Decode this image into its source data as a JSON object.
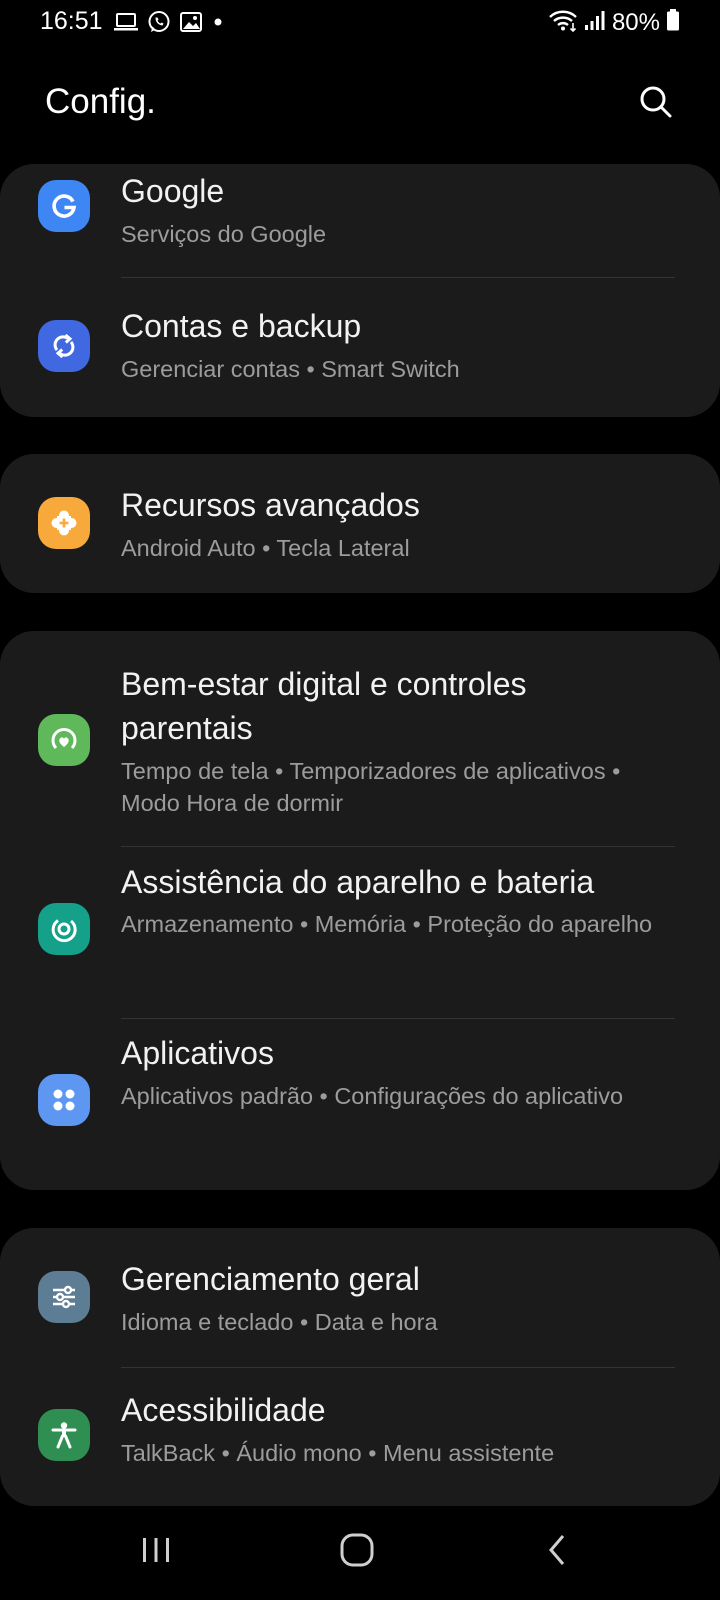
{
  "status_bar": {
    "time": "16:51",
    "notification_icons": [
      "laptop-icon",
      "whatsapp-icon",
      "gallery-icon",
      "dot-icon"
    ],
    "system_icons": [
      "wifi-icon",
      "signal-icon"
    ],
    "battery_percent": "80%"
  },
  "header": {
    "title": "Config.",
    "search_icon": "search-icon"
  },
  "settings": {
    "google": {
      "title": "Google",
      "subtitle": "Serviços do Google",
      "icon": "google-icon",
      "icon_color": "#3f86f5"
    },
    "accounts": {
      "title": "Contas e backup",
      "subtitle": "Gerenciar contas  •  Smart Switch",
      "icon": "sync-icon",
      "icon_color": "#4068e0"
    },
    "advanced": {
      "title": "Recursos avançados",
      "subtitle": "Android Auto  •  Tecla Lateral",
      "icon": "puzzle-plus-icon",
      "icon_color": "#f8a93b"
    },
    "wellbeing": {
      "title": "Bem-estar digital e controles\nparentais",
      "subtitle": "Tempo de tela  •  Temporizadores de aplicativos  •  Modo Hora de dormir",
      "icon": "wellbeing-icon",
      "icon_color": "#5fb85a"
    },
    "device_care": {
      "title": "Assistência do aparelho e bateria",
      "subtitle": "Armazenamento  •  Memória  •  Proteção do aparelho",
      "icon": "device-care-icon",
      "icon_color": "#15a08a"
    },
    "apps": {
      "title": "Aplicativos",
      "subtitle": "Aplicativos padrão  •  Configurações do aplicativo",
      "icon": "apps-grid-icon",
      "icon_color": "#5d97f2"
    },
    "general": {
      "title": "Gerenciamento geral",
      "subtitle": "Idioma e teclado  •  Data e hora",
      "icon": "sliders-icon",
      "icon_color": "#5d7d95"
    },
    "accessibility": {
      "title": "Acessibilidade",
      "subtitle": "TalkBack  •  Áudio mono  •  Menu assistente",
      "icon": "accessibility-icon",
      "icon_color": "#2f8e52"
    }
  },
  "nav_bar": {
    "recents_icon": "recents-icon",
    "home_icon": "home-icon",
    "back_icon": "back-icon"
  }
}
